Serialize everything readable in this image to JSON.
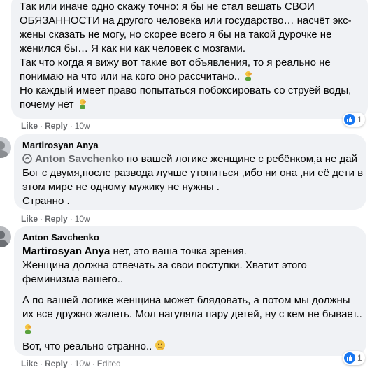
{
  "comment1": {
    "lines": [
      "Так или иначе одно скажу точно: я бы не стал вешать СВОИ",
      "ОБЯЗАННОСТИ на другого человека или государство… насчёт экс-",
      "жены сказать не могу, но скорее всего я бы на такой дурочке не",
      "женился бы… Я как ни как человек с мозгами.",
      "Так что когда я вижу вот такие вот объявления, то я реально не",
      "понимаю на что или на кого оно рассчитано..",
      "Но каждый имеет право попытаться побоксировать со струёй воды,",
      "почему нет"
    ],
    "actions": {
      "like": "Like",
      "reply": "Reply",
      "time": "10w"
    },
    "reactions": {
      "count": "1"
    }
  },
  "comment2": {
    "author": "Martirosyan Anya",
    "mention": "Anton Savchenko",
    "lines": [
      "по вашей логике женщине с ребёнком,а не дай",
      "Бог с двумя,после развода лучше утопиться ,ибо ни она ,ни её дети в",
      "этом мире не одному мужику не нужны .",
      "Странно ."
    ],
    "actions": {
      "like": "Like",
      "reply": "Reply",
      "time": "10w"
    }
  },
  "comment3": {
    "author": "Anton Savchenko",
    "mention": "Martirosyan Anya",
    "lines": [
      "нет, это ваша точка зрения.",
      "Женщина должна отвечать за свои поступки. Хватит этого",
      "феминизма вашего..",
      "А по вашей логике женщина может блядовать, а потом мы должны",
      "их все дружно жалеть. Мол нагуляла пару детей, ну с кем не бывает..",
      "Вот, что реально странно.."
    ],
    "actions": {
      "like": "Like",
      "reply": "Reply",
      "time": "10w",
      "edited": "Edited"
    },
    "reactions": {
      "count": "1"
    }
  },
  "colors": {
    "bubble": "#f0f2f5",
    "mention": "#1b74e4",
    "like": "#1877f2",
    "meta": "#65676b"
  },
  "icons": [
    "facepalm-emoji",
    "thinking-emoji",
    "like-reaction-icon",
    "reply-arrow-icon"
  ]
}
